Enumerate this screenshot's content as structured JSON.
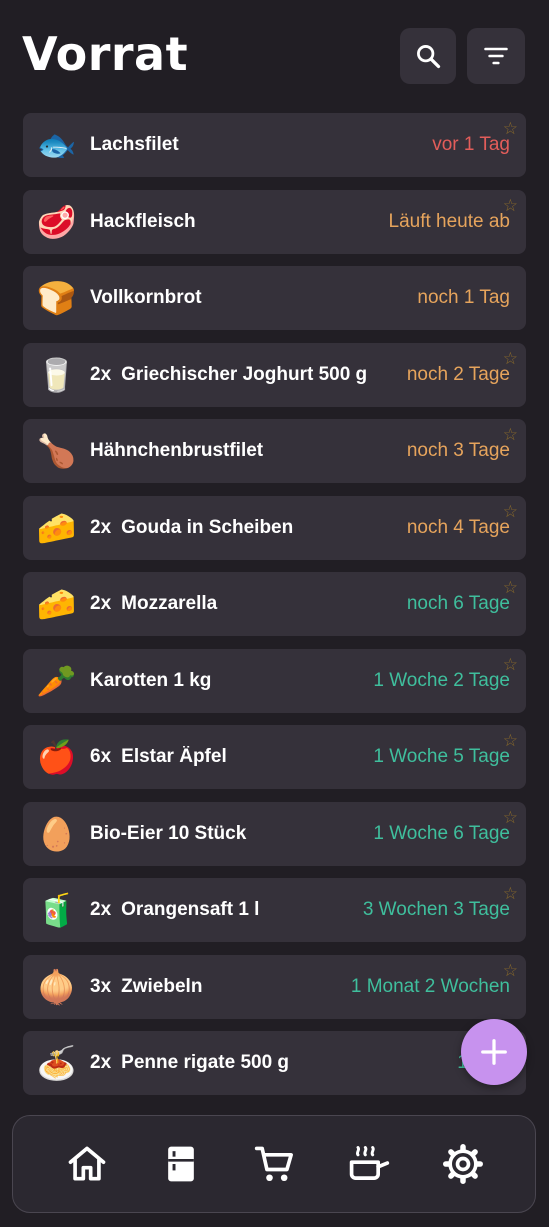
{
  "header": {
    "title": "Vorrat",
    "search_icon": "search-icon",
    "filter_icon": "filter-icon"
  },
  "colors": {
    "overdue": "#e35d5a",
    "soon": "#e6a45c",
    "ok": "#3fbf9d",
    "fab": "#c792ee",
    "card": "#35313a",
    "background": "#211e24"
  },
  "items": [
    {
      "emoji": "🐟",
      "qty": "",
      "name": "Lachsfilet",
      "expiry": "vor 1 Tag",
      "status": "overdue",
      "favorite": true
    },
    {
      "emoji": "🥩",
      "qty": "",
      "name": "Hackfleisch",
      "expiry": "Läuft heute ab",
      "status": "soon",
      "favorite": true
    },
    {
      "emoji": "🍞",
      "qty": "",
      "name": "Vollkornbrot",
      "expiry": "noch 1 Tag",
      "status": "soon",
      "favorite": false
    },
    {
      "emoji": "🥛",
      "qty": "2x",
      "name": "Griechischer Joghurt 500 g",
      "expiry": "noch 2 Tage",
      "status": "soon",
      "favorite": true
    },
    {
      "emoji": "🍗",
      "qty": "",
      "name": "Hähnchenbrustfilet",
      "expiry": "noch 3 Tage",
      "status": "soon",
      "favorite": true
    },
    {
      "emoji": "🧀",
      "qty": "2x",
      "name": "Gouda in Scheiben",
      "expiry": "noch 4 Tage",
      "status": "soon",
      "favorite": true
    },
    {
      "emoji": "🧀",
      "qty": "2x",
      "name": "Mozzarella",
      "expiry": "noch 6 Tage",
      "status": "ok",
      "favorite": true
    },
    {
      "emoji": "🥕",
      "qty": "",
      "name": "Karotten 1 kg",
      "expiry": "1 Woche 2 Tage",
      "status": "ok",
      "favorite": true
    },
    {
      "emoji": "🍎",
      "qty": "6x",
      "name": "Elstar Äpfel",
      "expiry": "1 Woche 5 Tage",
      "status": "ok",
      "favorite": true
    },
    {
      "emoji": "🥚",
      "qty": "",
      "name": "Bio-Eier 10 Stück",
      "expiry": "1 Woche 6 Tage",
      "status": "ok",
      "favorite": true
    },
    {
      "emoji": "🧃",
      "qty": "2x",
      "name": "Orangensaft 1 l",
      "expiry": "3 Wochen 3 Tage",
      "status": "ok",
      "favorite": true
    },
    {
      "emoji": "🧅",
      "qty": "3x",
      "name": "Zwiebeln",
      "expiry": "1 Monat 2 Wochen",
      "status": "ok",
      "favorite": true
    },
    {
      "emoji": "🍝",
      "qty": "2x",
      "name": "Penne rigate 500 g",
      "expiry": "10 Mo",
      "status": "ok",
      "favorite": false
    }
  ],
  "fab": {
    "icon": "plus-icon"
  },
  "nav": [
    {
      "name": "home",
      "icon": "home-icon"
    },
    {
      "name": "pantry",
      "icon": "fridge-icon"
    },
    {
      "name": "shopping",
      "icon": "cart-icon"
    },
    {
      "name": "cooking",
      "icon": "pot-icon"
    },
    {
      "name": "settings",
      "icon": "gear-icon"
    }
  ]
}
